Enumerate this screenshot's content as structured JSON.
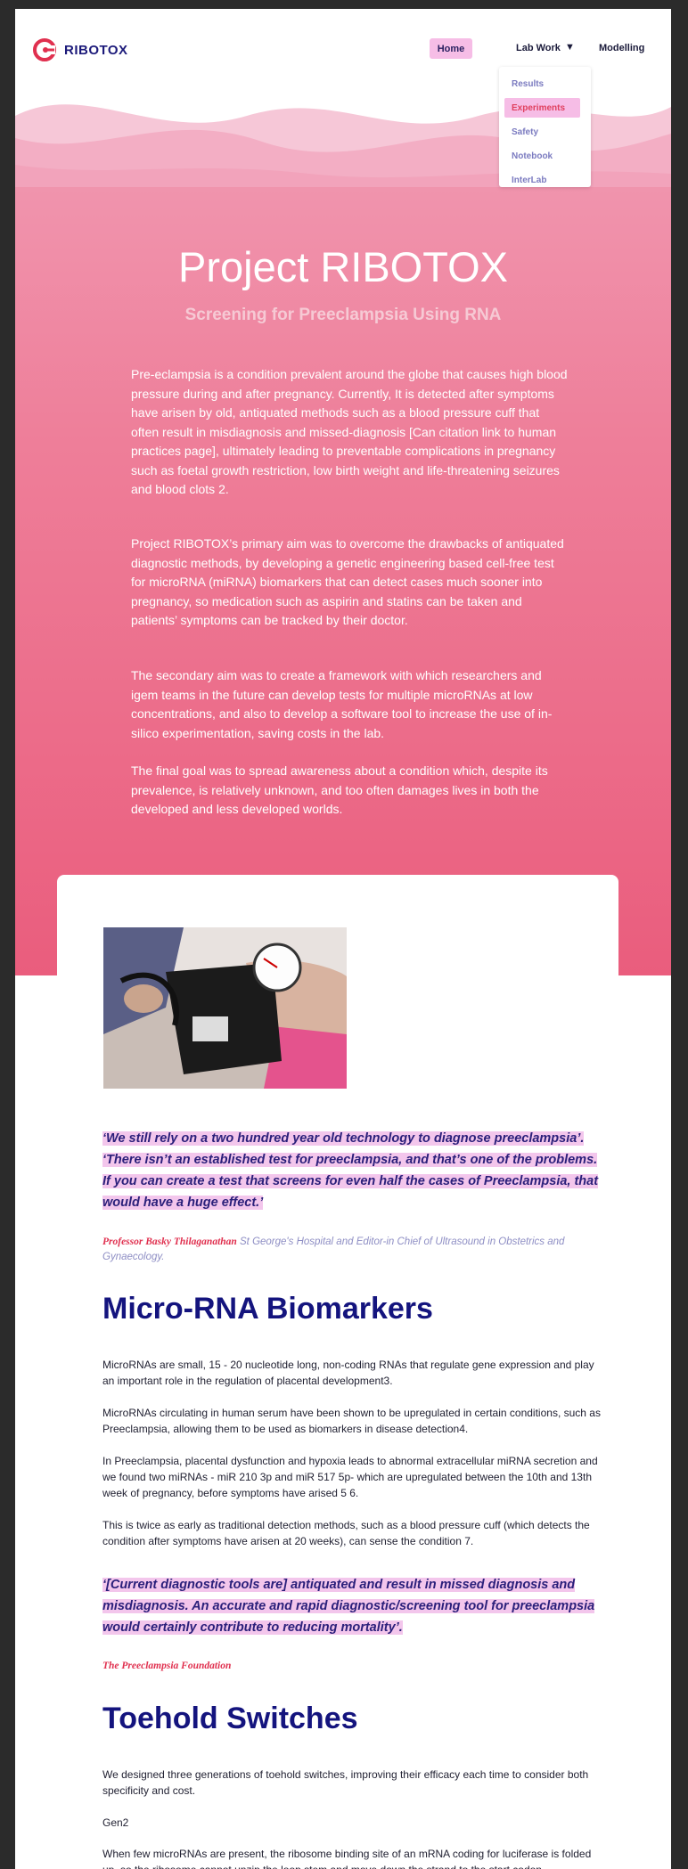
{
  "brand": {
    "name": "RIBOTOX",
    "logo_icon": "ribotox-logo-icon",
    "accent": "#e0304f",
    "navy": "#1c1a7a"
  },
  "nav": {
    "home": "Home",
    "lab_work": "Lab Work",
    "lab_work_caret": "▼",
    "modelling": "Modelling",
    "dropdown": [
      "Results",
      "Experiments",
      "Safety",
      "Notebook",
      "InterLab"
    ],
    "dropdown_active": "Experiments"
  },
  "hero": {
    "title": "Project RIBOTOX",
    "subtitle": "Screening for Preeclampsia Using RNA",
    "paragraphs": [
      "Pre-eclampsia is a condition prevalent around the globe that causes high blood pressure during and after pregnancy. Currently, It is detected after symptoms have arisen by old, antiquated methods such as a blood pressure cuff that often result in misdiagnosis and missed-diagnosis [Can citation link to human practices page], ultimately leading to preventable complications in pregnancy such as foetal growth restriction, low birth weight and life-threatening seizures and blood clots 2.",
      "Project RIBOTOX’s primary aim was to overcome the drawbacks of antiquated diagnostic methods, by developing a genetic engineering based cell-free test for microRNA (miRNA) biomarkers that can detect cases much sooner into pregnancy, so medication such as aspirin and statins can be taken and patients’ symptoms can be tracked by their doctor.",
      "The secondary aim was to create a framework with which researchers and igem teams in the future can develop tests for multiple microRNAs at low concentrations, and also to develop a software tool to increase the use of in-silico experimentation, saving costs in the lab.",
      "The final goal was to spread awareness about a condition which, despite its prevalence, is relatively unknown, and too often damages lives in both the developed and less developed worlds."
    ]
  },
  "quote1": {
    "text": "‘We still rely on a two hundred year old technology to diagnose preeclampsia’. ‘There isn’t an established test for preeclampsia, and that’s one of the problems. If you can create a test that screens for even half the cases of Preeclampsia, that would have a huge effect.’",
    "author": "Professor Basky Thilaganathan",
    "affiliation": " St George's Hospital and Editor-in Chief of Ultrasound in Obstetrics and Gynaecology."
  },
  "microrna": {
    "heading": "Micro-RNA Biomarkers",
    "paragraphs": [
      "MicroRNAs are small, 15 - 20 nucleotide long, non-coding RNAs that regulate gene expression and play an important role in the regulation of placental development3.",
      "MicroRNAs circulating in human serum have been shown to be upregulated in certain conditions, such as Preeclampsia, allowing them to be used as biomarkers in disease detection4.",
      "In Preeclampsia, placental dysfunction and hypoxia leads to abnormal extracellular miRNA secretion and we found two miRNAs - miR 210 3p and miR 517 5p- which are upregulated between the 10th and 13th week of pregnancy, before symptoms have arised 5 6.",
      "This is twice as early as traditional detection methods, such as a blood pressure cuff (which detects the condition after symptoms have arisen at 20 weeks), can sense the condition 7."
    ]
  },
  "quote2": {
    "text": "‘[Current diagnostic tools are] antiquated and result in missed diagnosis and misdiagnosis. An accurate and rapid diagnostic/screening tool for preeclampsia would certainly contribute to reducing mortality’.",
    "author": "The Preeclampsia Foundation"
  },
  "toehold": {
    "heading": "Toehold Switches",
    "paragraphs": [
      "We designed three generations of toehold switches, improving their efficacy each time to consider both specificity and cost.",
      "Gen2",
      "When few microRNAs are present, the ribosome binding site of an mRNA coding for luciferase is folded up, so the ribosome cannot unzip the loop stem and move down the strand to the start codon"
    ]
  }
}
